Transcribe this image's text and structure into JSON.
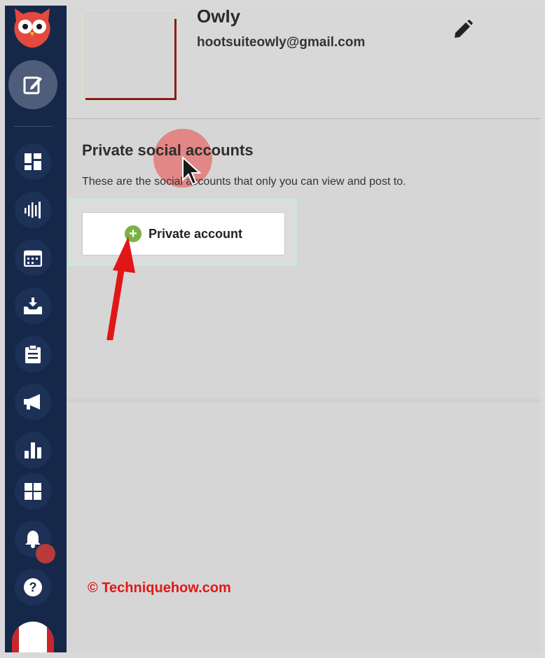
{
  "profile": {
    "name": "Owly",
    "email": "hootsuiteowly@gmail.com"
  },
  "section": {
    "title": "Private social accounts",
    "description": "These are the social accounts that only you can view and post to."
  },
  "private_button": {
    "label": "Private account",
    "icon": "plus-circle-icon"
  },
  "sidebar": {
    "items": [
      {
        "icon": "dashboard-icon"
      },
      {
        "icon": "streams-icon"
      },
      {
        "icon": "calendar-icon"
      },
      {
        "icon": "inbox-icon"
      },
      {
        "icon": "clipboard-icon"
      },
      {
        "icon": "megaphone-icon"
      },
      {
        "icon": "analytics-icon"
      },
      {
        "icon": "apps-icon"
      },
      {
        "icon": "bell-icon"
      },
      {
        "icon": "help-icon"
      }
    ]
  },
  "watermark": "© Techniquehow.com",
  "colors": {
    "sidebar": "#16284a",
    "accent_green": "#7bb243",
    "arrow_red": "#e11717",
    "owl_red": "#e5483d"
  }
}
